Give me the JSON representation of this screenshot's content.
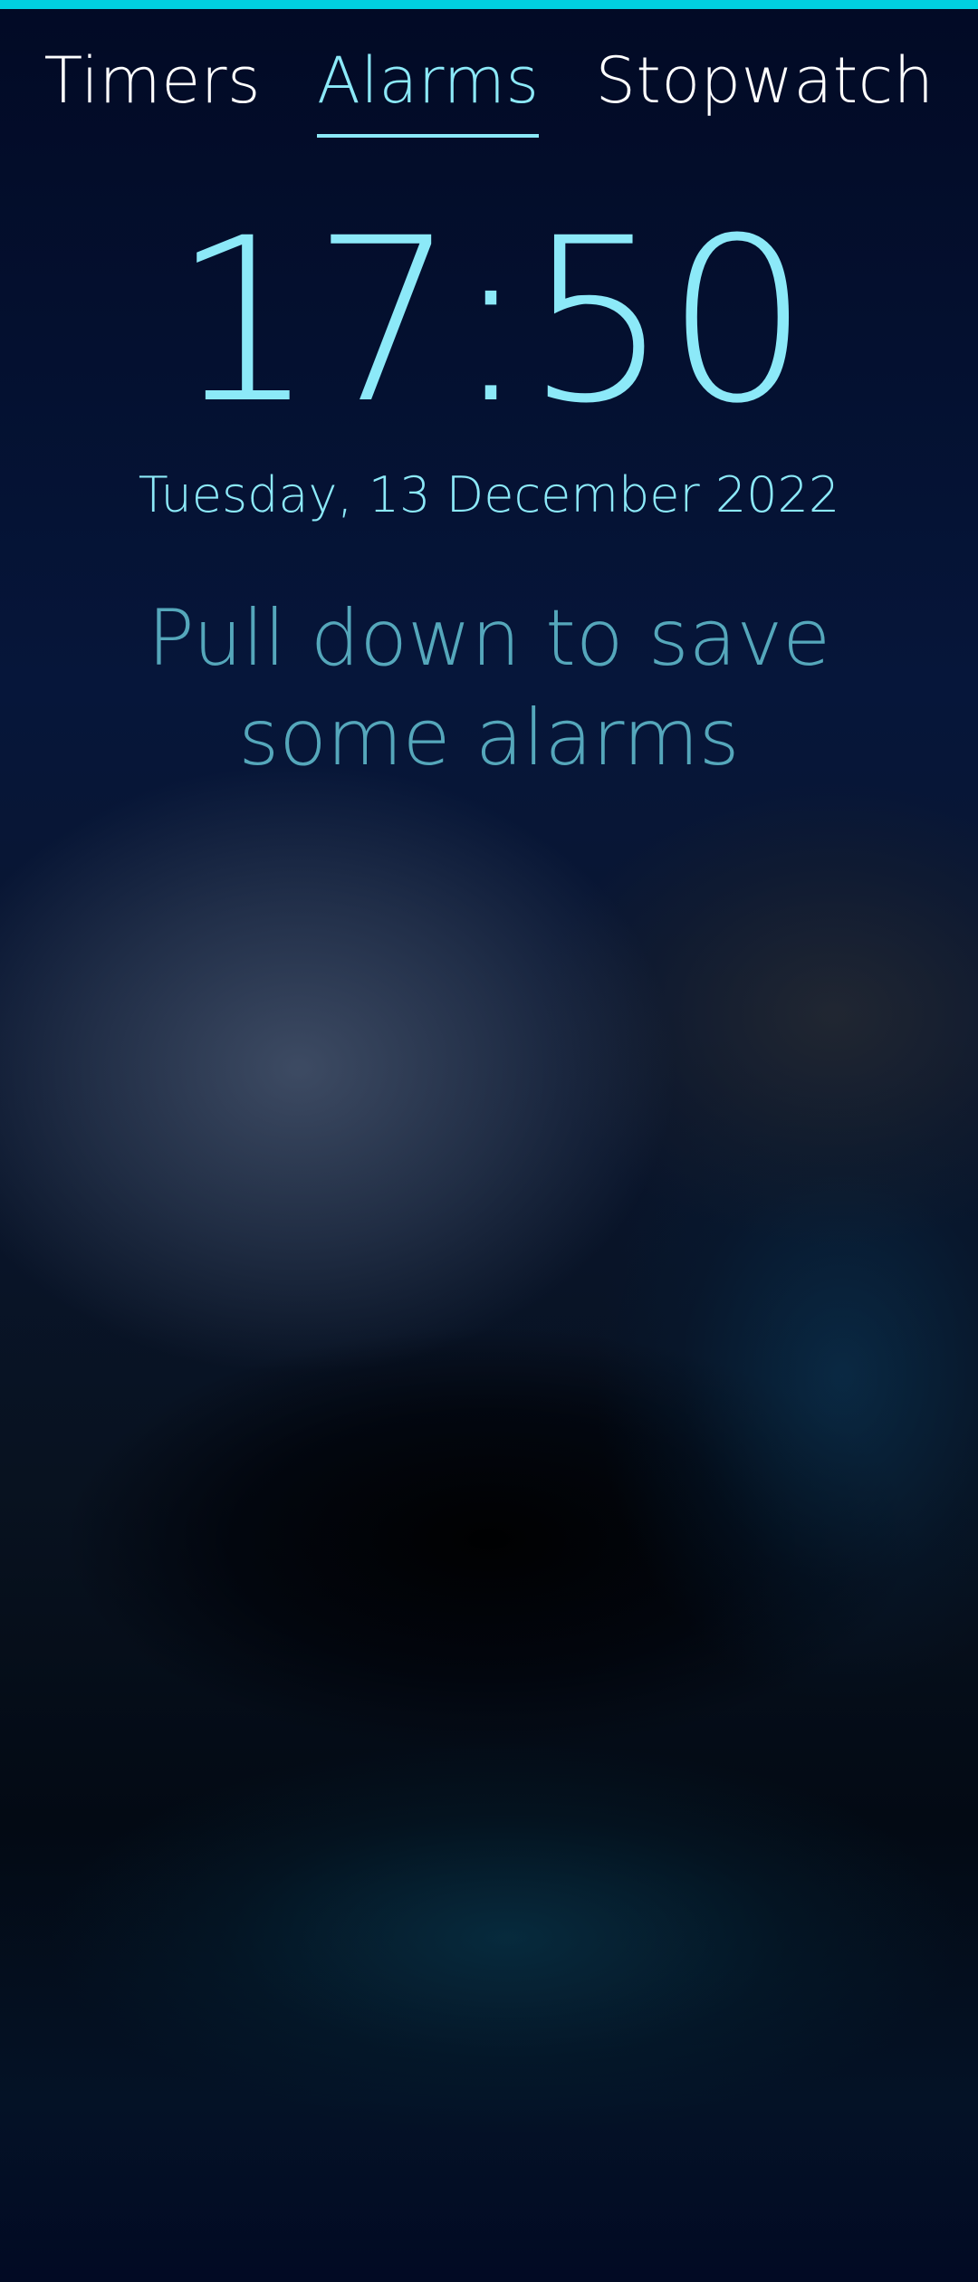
{
  "tabs": [
    {
      "label": "Timers",
      "active": false
    },
    {
      "label": "Alarms",
      "active": true
    },
    {
      "label": "Stopwatch",
      "active": false
    }
  ],
  "clock": {
    "time": "17:50",
    "date": "Tuesday, 13 December 2022"
  },
  "empty_state": {
    "hint": "Pull down to save some alarms"
  },
  "colors": {
    "accent": "#8ce9f8",
    "top_strip": "#00d0e0",
    "hint_text": "#55a7bb",
    "tab_text": "#ffffff"
  }
}
